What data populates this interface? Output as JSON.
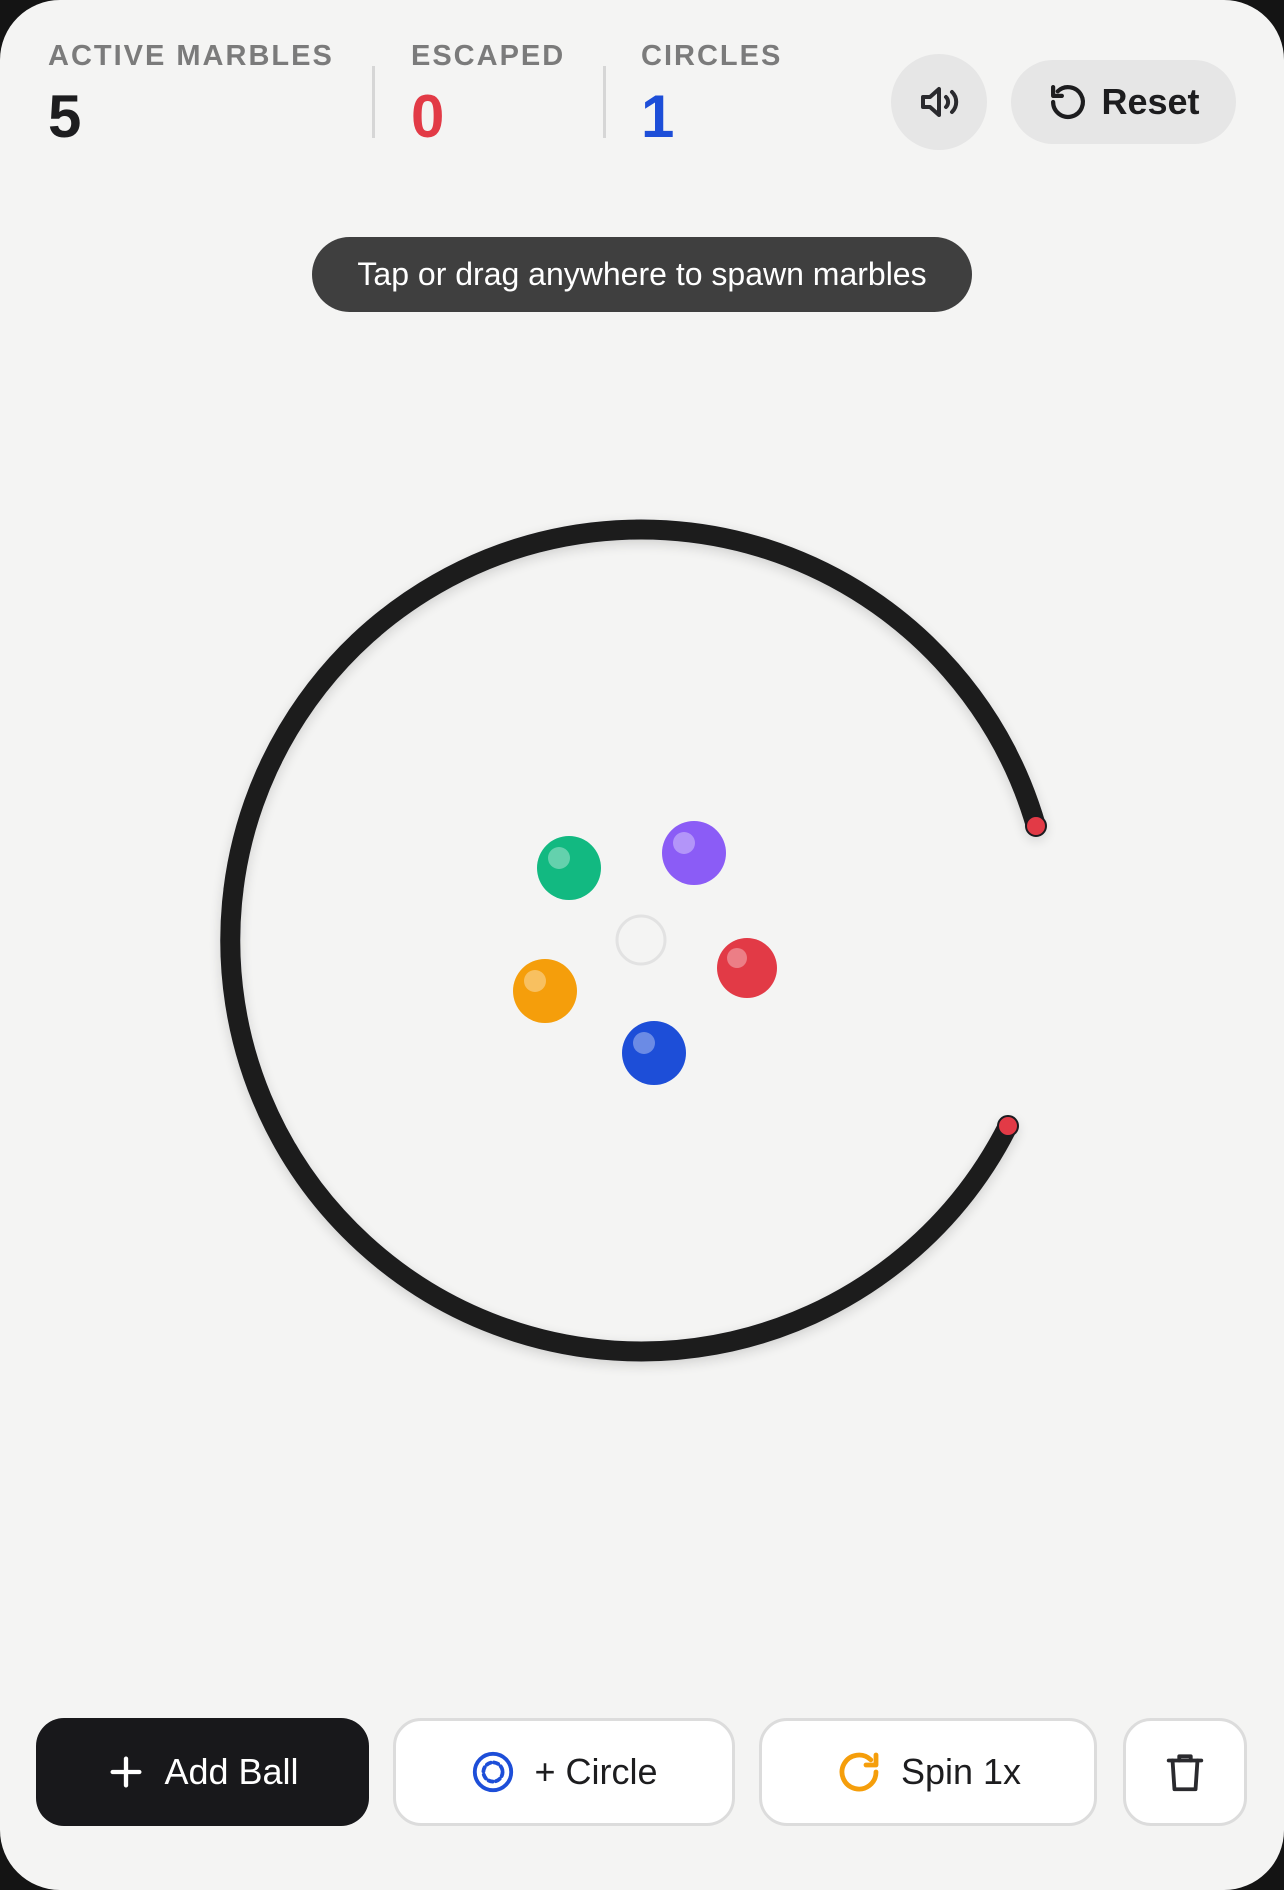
{
  "stats": {
    "active_marbles": {
      "label": "ACTIVE MARBLES",
      "value": "5",
      "color": "#1d1d1f"
    },
    "escaped": {
      "label": "ESCAPED",
      "value": "0",
      "color": "#e23a46"
    },
    "circles": {
      "label": "CIRCLES",
      "value": "1",
      "color": "#1d4ed8"
    }
  },
  "header": {
    "sound_icon": "speaker-icon",
    "reset_label": "Reset",
    "reset_icon": "rotate-ccw-icon"
  },
  "hint": "Tap or drag anywhere to spawn marbles",
  "arena": {
    "ring_color": "#1b1b1f",
    "gap_marker_color": "#e23a46",
    "marbles": [
      {
        "color": "green",
        "hex": "#12b981"
      },
      {
        "color": "purple",
        "hex": "#8b5cf6"
      },
      {
        "color": "orange",
        "hex": "#f59e0b"
      },
      {
        "color": "red",
        "hex": "#e23a46"
      },
      {
        "color": "blue",
        "hex": "#1d4ed8"
      }
    ]
  },
  "toolbar": {
    "add_ball": {
      "label": "Add Ball",
      "icon": "plus-icon"
    },
    "add_circle": {
      "label": "+ Circle",
      "icon": "circle-target-icon",
      "icon_color": "#1d4ed8"
    },
    "spin": {
      "label": "Spin 1x",
      "icon": "rotate-cw-icon",
      "icon_color": "#f59e0b"
    },
    "clear": {
      "icon": "trash-icon"
    }
  }
}
